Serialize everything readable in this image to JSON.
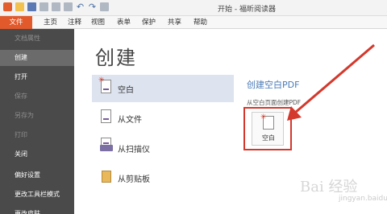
{
  "app": {
    "title": "开始 - 福昕阅读器"
  },
  "ribbon": {
    "file": "文件",
    "tabs": [
      "主页",
      "注释",
      "视图",
      "表单",
      "保护",
      "共享",
      "帮助"
    ]
  },
  "sidebar": {
    "items": [
      {
        "label": "文档属性",
        "state": "disabled"
      },
      {
        "label": "创建",
        "state": "active"
      },
      {
        "label": "打开",
        "state": "normal"
      },
      {
        "label": "保存",
        "state": "disabled"
      },
      {
        "label": "另存为",
        "state": "disabled"
      },
      {
        "label": "打印",
        "state": "disabled"
      },
      {
        "label": "关闭",
        "state": "normal"
      },
      {
        "label": "偏好设置",
        "state": "normal"
      },
      {
        "label": "更改工具栏模式",
        "state": "normal"
      },
      {
        "label": "更改皮肤",
        "state": "normal"
      }
    ]
  },
  "main": {
    "title": "创建",
    "options": [
      {
        "label": "空白",
        "icon": "blank-doc-icon"
      },
      {
        "label": "从文件",
        "icon": "file-doc-icon"
      },
      {
        "label": "从扫描仪",
        "icon": "scanner-icon"
      },
      {
        "label": "从剪贴板",
        "icon": "clipboard-icon"
      }
    ]
  },
  "detail": {
    "title": "创建空白PDF",
    "subtitle": "从空白页面创建PDF",
    "button_label": "空白"
  },
  "watermark": {
    "text": "Bai 经验",
    "sub": "jingyan.baidu.com"
  },
  "colors": {
    "accent": "#e2592b",
    "sidebar": "#4a4a4a",
    "highlight": "#d4382c",
    "link": "#4a7ab6"
  }
}
